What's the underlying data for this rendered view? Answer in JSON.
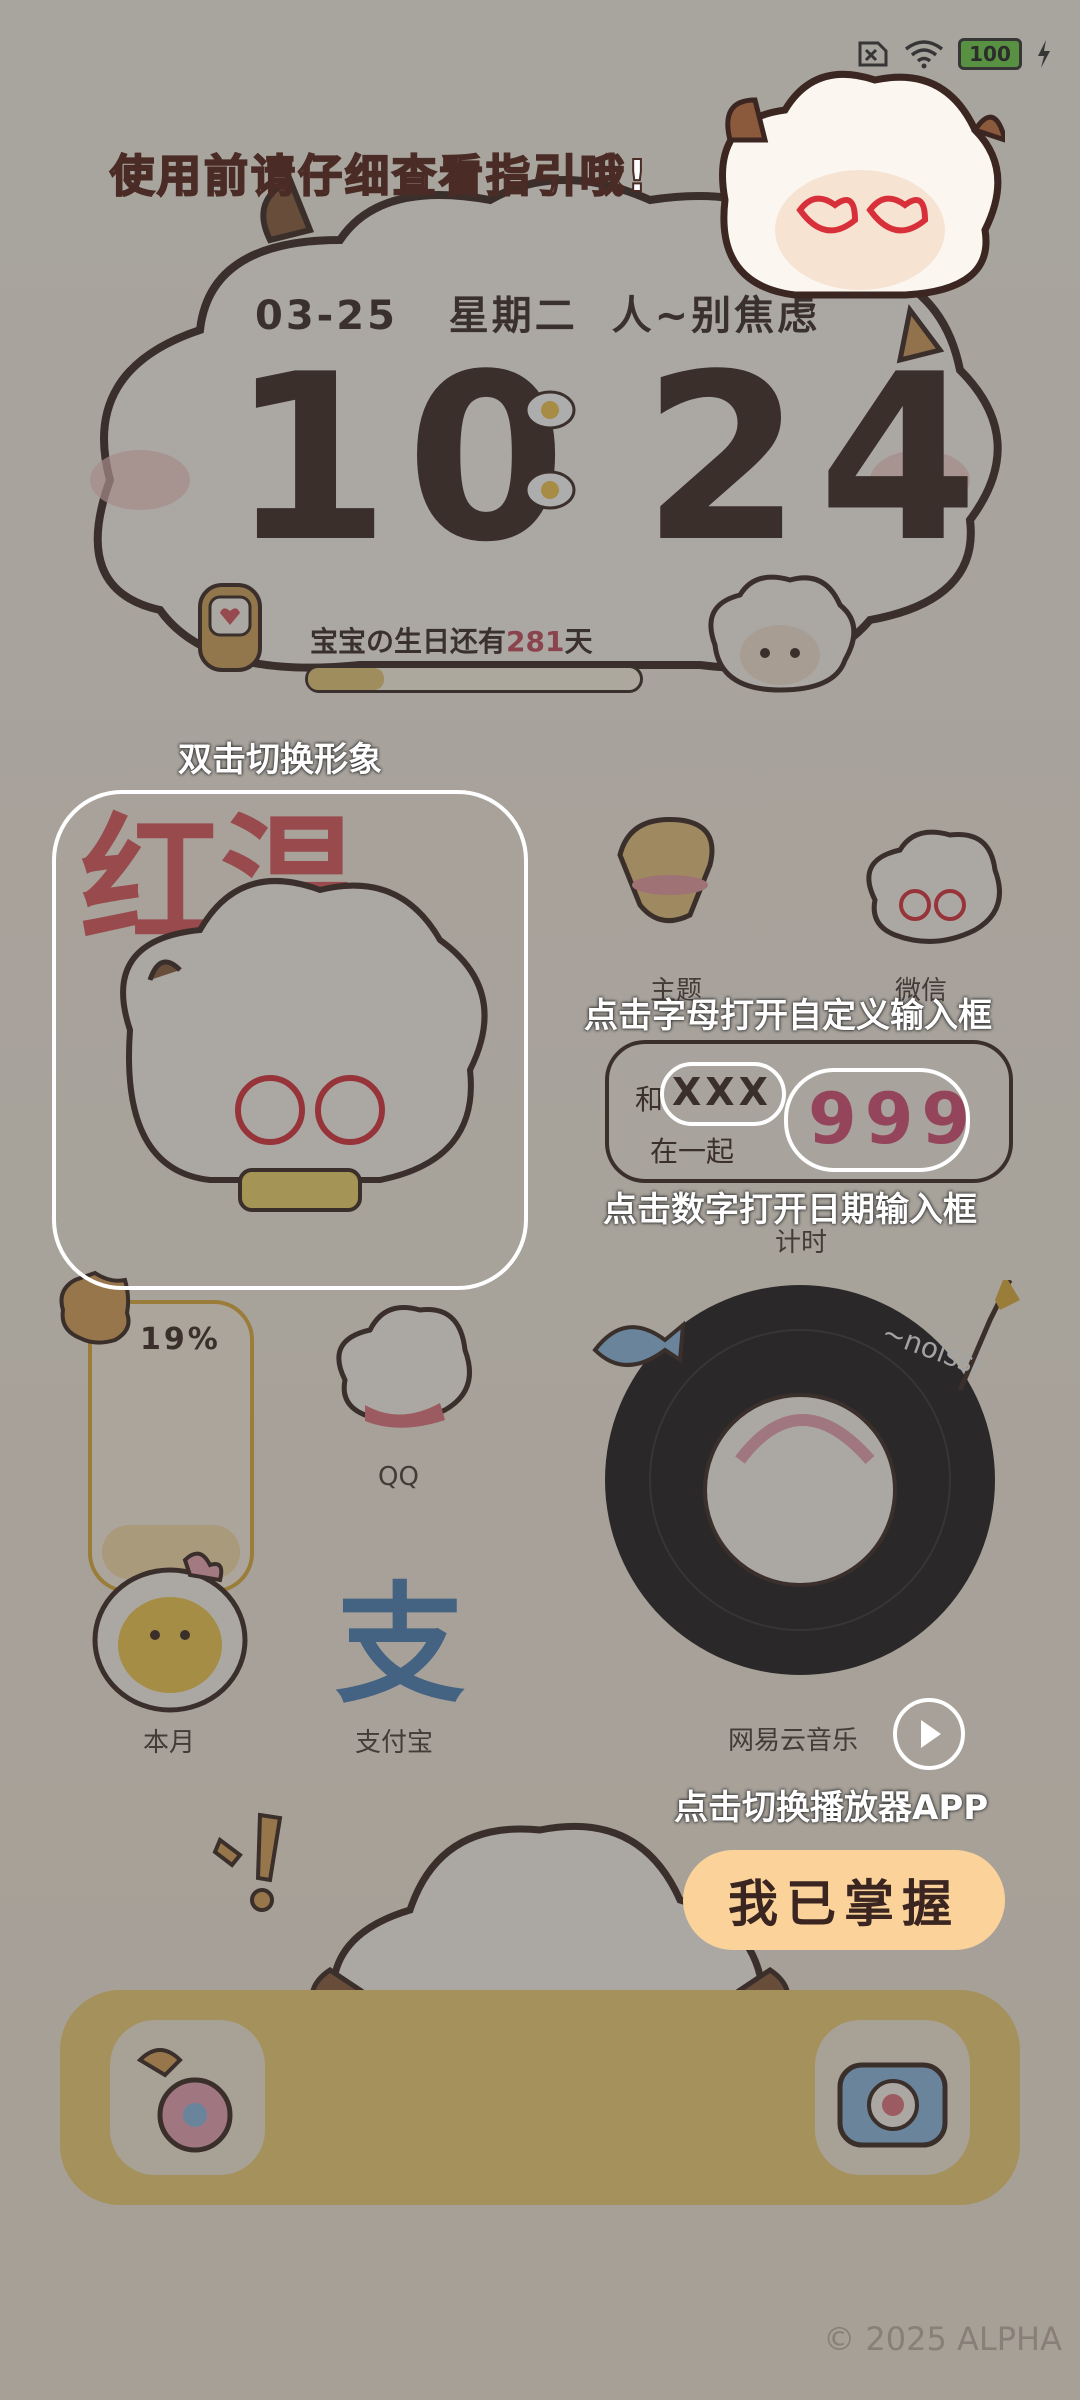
{
  "status_bar": {
    "battery": "100"
  },
  "guide": {
    "title": "使用前请仔细查看指引哦!",
    "double_tap": "双击切换形象",
    "letters": "点击字母打开自定义输入框",
    "digits": "点击数字打开日期输入框",
    "switch_player": "点击切换播放器APP",
    "master_button": "我已掌握"
  },
  "clock_widget": {
    "date": "03-25",
    "weekday": "星期二",
    "message": "人~别焦虑",
    "hour": "10",
    "minute": "24",
    "birthday_prefix": "宝宝の生日还有",
    "birthday_days": "281",
    "birthday_suffix": "天",
    "birthday_progress": 0.23
  },
  "photo_widget": {
    "caption": "红温"
  },
  "apps": {
    "theme": "主题",
    "wechat": "微信",
    "qq": "QQ",
    "month": "本月",
    "alipay": "支付宝",
    "netease": "网易云音乐",
    "alipay_char": "支"
  },
  "countdown_widget": {
    "with": "和",
    "name": "XXX",
    "together": "在一起",
    "days": "999",
    "label": "计时"
  },
  "month_widget": {
    "percent": "19%"
  },
  "music_widget": {
    "vinyl_text": "~noissi"
  },
  "copyright": "© 2025 ALPHA",
  "colors": {
    "accent_yellow": "#f1cf72",
    "button": "#fbd39a",
    "text_dark": "#3b2622",
    "red": "#c44a5a"
  }
}
